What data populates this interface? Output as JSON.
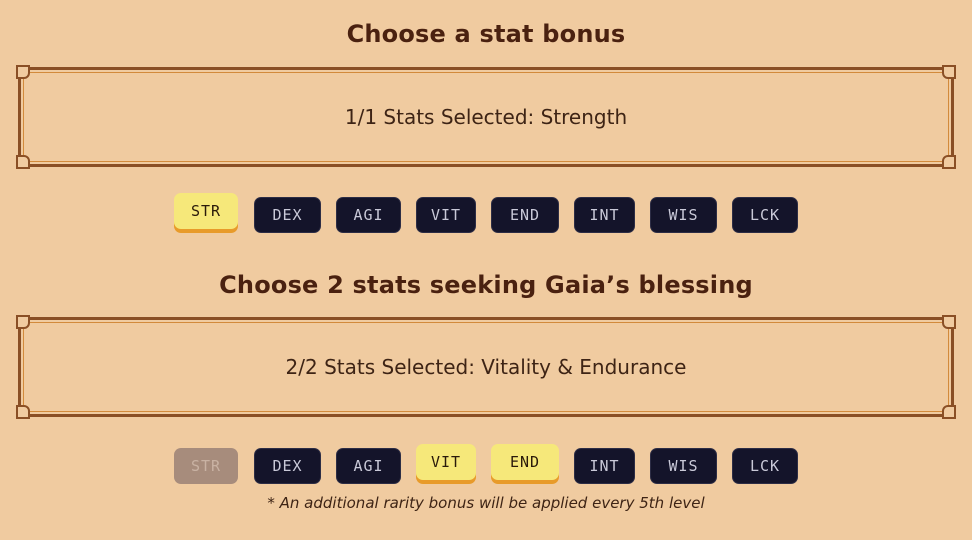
{
  "bonus_section": {
    "title": "Choose a stat bonus",
    "status_text": "1/1 Stats Selected: Strength",
    "stats": [
      {
        "label": "STR",
        "state": "selected"
      },
      {
        "label": "DEX",
        "state": "normal"
      },
      {
        "label": "AGI",
        "state": "normal"
      },
      {
        "label": "VIT",
        "state": "normal"
      },
      {
        "label": "END",
        "state": "normal"
      },
      {
        "label": "INT",
        "state": "normal"
      },
      {
        "label": "WIS",
        "state": "normal"
      },
      {
        "label": "LCK",
        "state": "normal"
      }
    ]
  },
  "blessing_section": {
    "title": "Choose 2 stats seeking Gaia’s blessing",
    "status_text": "2/2 Stats Selected: Vitality & Endurance",
    "stats": [
      {
        "label": "STR",
        "state": "disabled"
      },
      {
        "label": "DEX",
        "state": "normal"
      },
      {
        "label": "AGI",
        "state": "normal"
      },
      {
        "label": "VIT",
        "state": "selected"
      },
      {
        "label": "END",
        "state": "selected"
      },
      {
        "label": "INT",
        "state": "normal"
      },
      {
        "label": "WIS",
        "state": "normal"
      },
      {
        "label": "LCK",
        "state": "normal"
      }
    ]
  },
  "footnote": "* An additional rarity bonus will be applied every 5th level",
  "colors": {
    "background": "#f0cba0",
    "button_dark": "#14142a",
    "button_selected": "#f6e87a",
    "button_selected_shadow": "#e89b2a",
    "button_disabled": "#a78c7c",
    "title_text": "#4a2110",
    "frame_border": "#8a4f25"
  }
}
